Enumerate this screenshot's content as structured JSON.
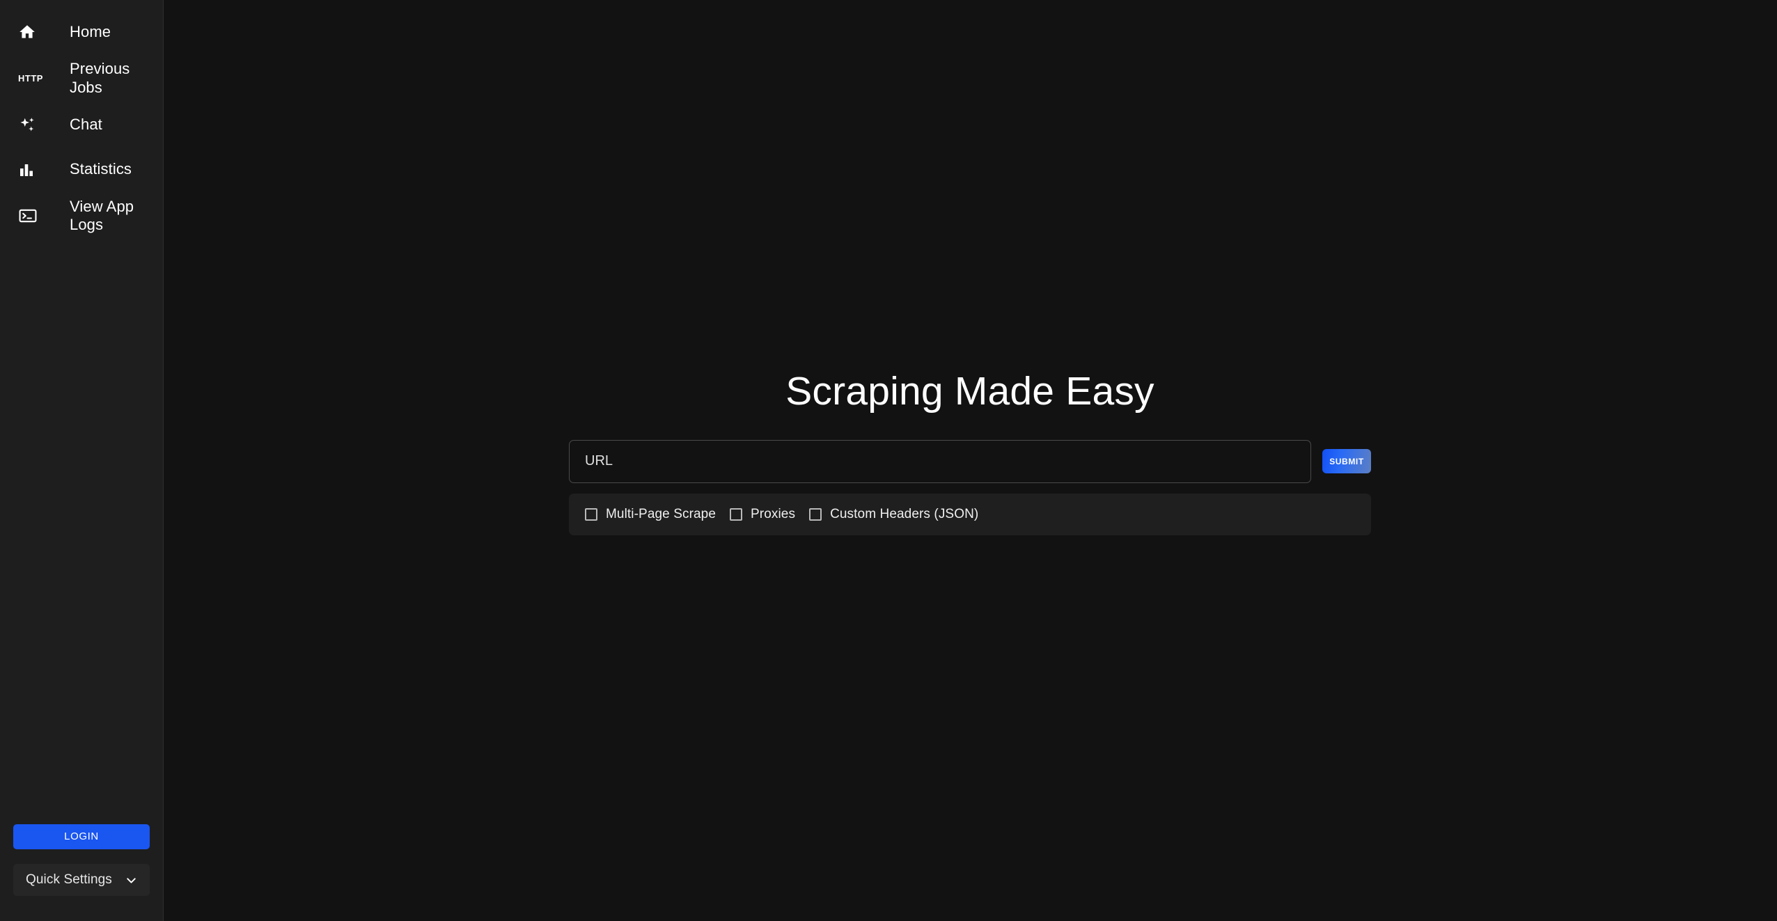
{
  "sidebar": {
    "items": [
      {
        "label": "Home",
        "icon": "home-icon"
      },
      {
        "label": "Previous Jobs",
        "icon": "http-icon",
        "icon_text": "HTTP"
      },
      {
        "label": "Chat",
        "icon": "sparkles-icon"
      },
      {
        "label": "Statistics",
        "icon": "bar-chart-icon"
      },
      {
        "label": "View App Logs",
        "icon": "terminal-icon"
      }
    ],
    "login_label": "LOGIN",
    "quick_settings_label": "Quick Settings",
    "chevron_icon": "chevron-down-icon"
  },
  "main": {
    "title": "Scraping Made Easy",
    "url_input": {
      "placeholder": "URL",
      "value": ""
    },
    "submit_label": "SUBMIT",
    "options": [
      {
        "label": "Multi-Page Scrape",
        "checked": false
      },
      {
        "label": "Proxies",
        "checked": false
      },
      {
        "label": "Custom Headers (JSON)",
        "checked": false
      }
    ]
  },
  "colors": {
    "page_background": "#121212",
    "sidebar_background": "#1e1e1e",
    "options_bar_background": "#1f1f1f",
    "accent_blue": "#1a56f0",
    "submit_gradient_start": "#1250f5",
    "submit_gradient_end": "#5c7fc4",
    "text_primary": "#ffffff",
    "border": "#4a4a4a"
  }
}
